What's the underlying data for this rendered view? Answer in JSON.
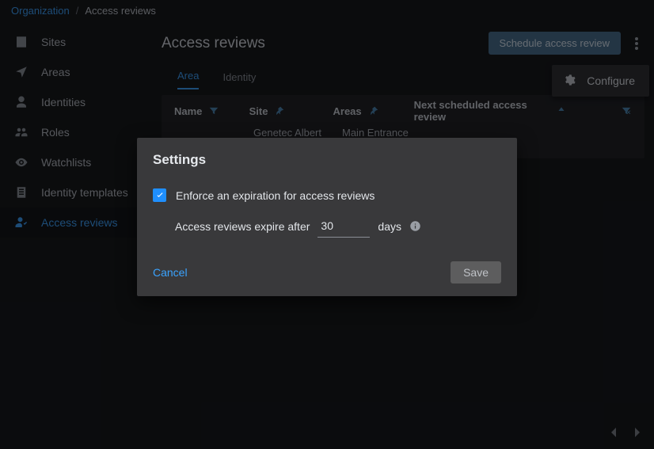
{
  "breadcrumb": {
    "org": "Organization",
    "current": "Access reviews"
  },
  "sidebar": {
    "items": [
      {
        "label": "Sites"
      },
      {
        "label": "Areas"
      },
      {
        "label": "Identities"
      },
      {
        "label": "Roles"
      },
      {
        "label": "Watchlists"
      },
      {
        "label": "Identity templates"
      },
      {
        "label": "Access reviews"
      }
    ]
  },
  "page": {
    "title": "Access reviews",
    "schedule_btn": "Schedule access review",
    "configure_label": "Configure"
  },
  "tabs": {
    "area": "Area",
    "identity": "Identity"
  },
  "table": {
    "cols": {
      "name": "Name",
      "site": "Site",
      "areas": "Areas",
      "next": "Next scheduled access review"
    },
    "rows": [
      {
        "name": "",
        "site": "Genetec Albert",
        "areas": "Main Entrance"
      }
    ]
  },
  "dialog": {
    "title": "Settings",
    "enforce_label": "Enforce an expiration for access reviews",
    "expire_prefix": "Access reviews expire after",
    "expire_value": "30",
    "expire_suffix": "days",
    "cancel": "Cancel",
    "save": "Save"
  }
}
